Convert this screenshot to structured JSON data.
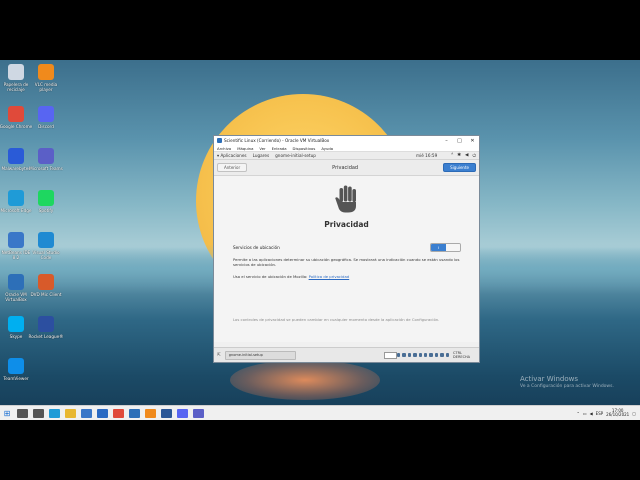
{
  "desktop": {
    "icons": [
      {
        "label": "Papelera de reciclaje",
        "color": "#cfd8e3"
      },
      {
        "label": "VLC media player",
        "color": "#f08a1c"
      },
      {
        "label": "Google Chrome",
        "color": "#e04a3a"
      },
      {
        "label": "Discord",
        "color": "#5865f2"
      },
      {
        "label": "Malwarebytes",
        "color": "#2a5bd7"
      },
      {
        "label": "Microsoft Teams",
        "color": "#5b5fc7"
      },
      {
        "label": "Microsoft Edge",
        "color": "#1f9bd7"
      },
      {
        "label": "Spotify",
        "color": "#1ed760"
      },
      {
        "label": "NetBeans IDE 8.2",
        "color": "#3a77c8"
      },
      {
        "label": "Visual Studio Code",
        "color": "#1f8ad2"
      },
      {
        "label": "Oracle VM VirtualBox",
        "color": "#2d6fb8"
      },
      {
        "label": "DVD Mic Client",
        "color": "#d85a2a"
      },
      {
        "label": "Skype",
        "color": "#00aff0"
      },
      {
        "label": "Rocket League®",
        "color": "#2c4fa0"
      },
      {
        "label": "TeamViewer",
        "color": "#0e8ee9"
      }
    ],
    "activation_title": "Activar Windows",
    "activation_sub": "Ve a Configuración para activar Windows."
  },
  "vbox": {
    "title": "Scientific Linux (Corriendo) - Oracle VM VirtualBox",
    "menu": [
      "Archivo",
      "Máquina",
      "Ver",
      "Entrada",
      "Dispositivos",
      "Ayuda"
    ],
    "status_host_key": "CTRL DERECHA"
  },
  "gnome": {
    "apps": "Aplicaciones",
    "places": "Lugares",
    "current_app": "gnome-initial-setup",
    "clock": "mié 16:59"
  },
  "setup": {
    "prev_label": "Anterior",
    "header_title": "Privacidad",
    "next_label": "Siguiente",
    "page_title": "Privacidad",
    "location_label": "Servicios de ubicación",
    "location_enabled": true,
    "switch_on_text": "I",
    "location_desc": "Permite a las aplicaciones determinar su ubicación geográfica. Se mostrará una indicación cuando se están usando los servicios de ubicación.",
    "mozilla_text": "Usa el servicio de ubicación de Mozilla:",
    "mozilla_link": "Política de privacidad",
    "footer_note": "Los controles de privacidad se pueden cambiar en cualquier momento desde la aplicación de Configuración.",
    "taskbutton_label": "gnome-initial-setup"
  },
  "taskbar": {
    "apps": [
      {
        "name": "search-icon",
        "color": "#555555"
      },
      {
        "name": "task-view-icon",
        "color": "#555555"
      },
      {
        "name": "edge-icon",
        "color": "#1f9bd7"
      },
      {
        "name": "file-explorer-icon",
        "color": "#e8b730"
      },
      {
        "name": "store-icon",
        "color": "#3a77c8"
      },
      {
        "name": "mail-icon",
        "color": "#2a6ac3"
      },
      {
        "name": "chrome-icon",
        "color": "#e04a3a"
      },
      {
        "name": "virtualbox-icon",
        "color": "#2d6fb8"
      },
      {
        "name": "vlc-icon",
        "color": "#f08a1c"
      },
      {
        "name": "word-icon",
        "color": "#2b5797"
      },
      {
        "name": "discord-icon",
        "color": "#5865f2"
      },
      {
        "name": "teams-icon",
        "color": "#5b5fc7"
      }
    ],
    "lang": "ESP",
    "time": "17:00",
    "date": "26/10/2021"
  }
}
